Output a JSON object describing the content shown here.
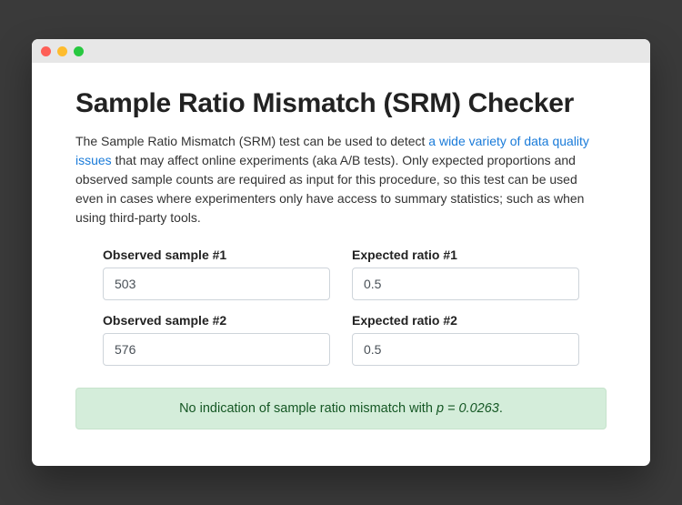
{
  "page": {
    "title": "Sample Ratio Mismatch (SRM) Checker",
    "intro_prefix": "The Sample Ratio Mismatch (SRM) test can be used to detect ",
    "intro_link_text": "a wide variety of data quality issues",
    "intro_suffix": " that may affect online experiments (aka A/B tests). Only expected proportions and observed sample counts are required as input for this procedure, so this test can be used even in cases where experimenters only have access to summary statistics; such as when using third-party tools."
  },
  "form": {
    "observed1_label": "Observed sample #1",
    "observed1_value": "503",
    "ratio1_label": "Expected ratio #1",
    "ratio1_value": "0.5",
    "observed2_label": "Observed sample #2",
    "observed2_value": "576",
    "ratio2_label": "Expected ratio #2",
    "ratio2_value": "0.5"
  },
  "result": {
    "message_prefix": "No indication of sample ratio mismatch with ",
    "p_label": "p = 0.0263",
    "message_suffix": "."
  },
  "colors": {
    "link": "#1a7bd9",
    "success_bg": "#d4edda",
    "success_text": "#155724"
  }
}
